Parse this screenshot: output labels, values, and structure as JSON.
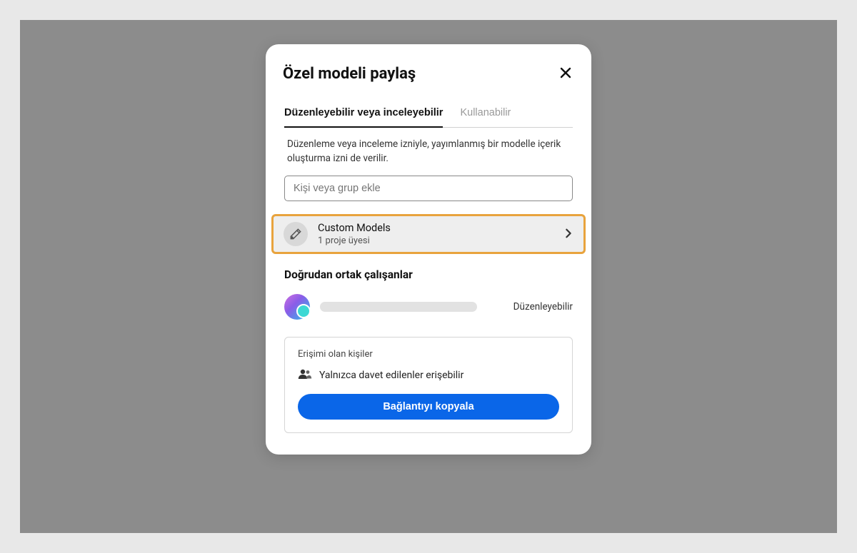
{
  "modal": {
    "title": "Özel modeli paylaş",
    "tabs": {
      "edit_review": "Düzenleyebilir veya inceleyebilir",
      "usable": "Kullanabilir"
    },
    "helper": "Düzenleme veya inceleme izniyle, yayımlanmış bir modelle içerik oluşturma izni de verilir.",
    "input_placeholder": "Kişi veya grup ekle",
    "project": {
      "title": "Custom Models",
      "subtitle": "1 proje üyesi"
    },
    "collaborators": {
      "heading": "Doğrudan ortak çalışanlar",
      "role": "Düzenleyebilir"
    },
    "access": {
      "heading": "Erişimi olan kişiler",
      "text": "Yalnızca davet edilenler erişebilir",
      "copy_button": "Bağlantıyı kopyala"
    }
  }
}
